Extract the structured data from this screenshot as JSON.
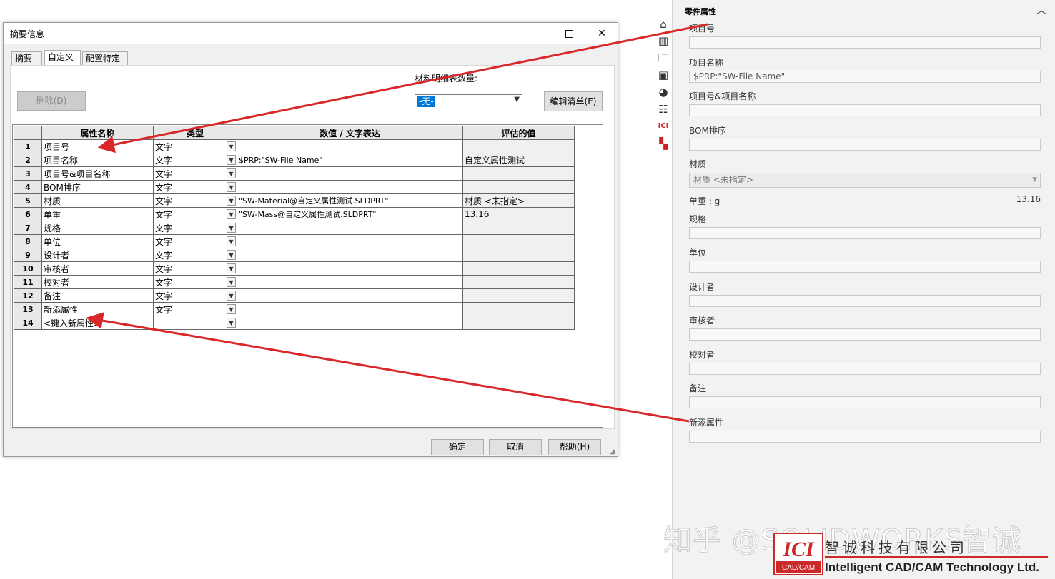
{
  "dialog": {
    "title": "摘要信息",
    "tabs": [
      "摘要",
      "自定义",
      "配置特定"
    ],
    "active_tab": "自定义",
    "delete_label": "删除(D)",
    "bom_qty_label": "材料明细表数量:",
    "bom_qty_value": "-无-",
    "edit_list_label": "编辑清单(E)",
    "columns": [
      "属性名称",
      "类型",
      "数值 / 文字表达",
      "评估的值"
    ],
    "rows": [
      {
        "num": "1",
        "name": "项目号",
        "type": "文字",
        "value": "",
        "evaluated": ""
      },
      {
        "num": "2",
        "name": "项目名称",
        "type": "文字",
        "value": "$PRP:\"SW-File Name\"",
        "evaluated": "自定义属性测试"
      },
      {
        "num": "3",
        "name": "项目号&项目名称",
        "type": "文字",
        "value": "",
        "evaluated": ""
      },
      {
        "num": "4",
        "name": "BOM排序",
        "type": "文字",
        "value": "",
        "evaluated": ""
      },
      {
        "num": "5",
        "name": "材质",
        "type": "文字",
        "value": "\"SW-Material@自定义属性测试.SLDPRT\"",
        "evaluated": "材质 <未指定>"
      },
      {
        "num": "6",
        "name": "单重",
        "type": "文字",
        "value": "\"SW-Mass@自定义属性测试.SLDPRT\"",
        "evaluated": "13.16"
      },
      {
        "num": "7",
        "name": "规格",
        "type": "文字",
        "value": "",
        "evaluated": ""
      },
      {
        "num": "8",
        "name": "单位",
        "type": "文字",
        "value": "",
        "evaluated": ""
      },
      {
        "num": "9",
        "name": "设计者",
        "type": "文字",
        "value": "",
        "evaluated": ""
      },
      {
        "num": "10",
        "name": "审核者",
        "type": "文字",
        "value": "",
        "evaluated": ""
      },
      {
        "num": "11",
        "name": "校对者",
        "type": "文字",
        "value": "",
        "evaluated": ""
      },
      {
        "num": "12",
        "name": "备注",
        "type": "文字",
        "value": "",
        "evaluated": ""
      },
      {
        "num": "13",
        "name": "新添属性",
        "type": "文字",
        "value": "",
        "evaluated": ""
      },
      {
        "num": "14",
        "name": "<键入新属性>",
        "type": "",
        "value": "",
        "evaluated": ""
      }
    ],
    "ok_label": "确定",
    "cancel_label": "取消",
    "help_label": "帮助(H)"
  },
  "side_toolbar": {
    "icons": [
      "home-icon",
      "parts-library-icon",
      "open-folder-icon",
      "view-palette-icon",
      "appearances-icon",
      "custom-properties-icon",
      "ici-addin-icon",
      "solidworks-forum-icon"
    ]
  },
  "properties_panel": {
    "title": "零件属性",
    "fields": [
      {
        "label": "项目号",
        "value": ""
      },
      {
        "label": "项目名称",
        "value": "$PRP:\"SW-File Name\""
      },
      {
        "label": "项目号&项目名称",
        "value": ""
      },
      {
        "label": "BOM排序",
        "value": ""
      },
      {
        "label": "材质",
        "value": "材质 <未指定>"
      },
      {
        "label": "单重 : g",
        "value": "13.16"
      },
      {
        "label": "规格",
        "value": ""
      },
      {
        "label": "单位",
        "value": ""
      },
      {
        "label": "设计者",
        "value": ""
      },
      {
        "label": "审核者",
        "value": ""
      },
      {
        "label": "校对者",
        "value": ""
      },
      {
        "label": "备注",
        "value": ""
      },
      {
        "label": "新添属性",
        "value": ""
      }
    ]
  },
  "watermark": {
    "zhihu": "知乎 @SOLIDWORKS智诚",
    "logo_text": "ICI",
    "logo_sub": "CAD/CAM",
    "company_cn": "智诚科技有限公司",
    "company_en": "Intelligent CAD/CAM Technology Ltd."
  },
  "colors": {
    "annotation_arrow": "#d8282a",
    "selection_blue": "#0078d7",
    "logo_red": "#cc2a2a"
  }
}
